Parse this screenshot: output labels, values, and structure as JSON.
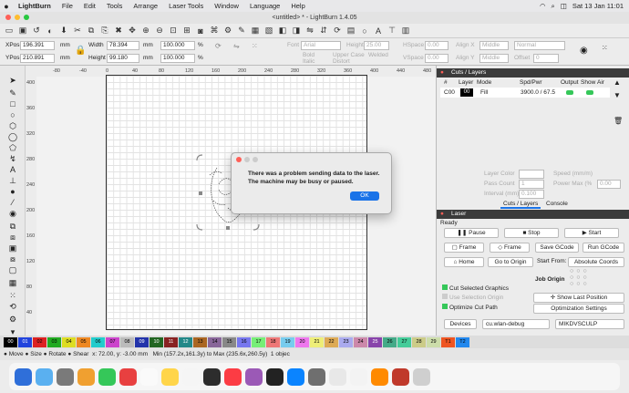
{
  "menubar": {
    "apple": "",
    "app": "LightBurn",
    "items": [
      "File",
      "Edit",
      "Tools",
      "Arrange",
      "Laser Tools",
      "Window",
      "Language",
      "Help"
    ],
    "datetime": "Sat 13 Jan  11:01"
  },
  "window": {
    "title": "<untitled> * - LightBurn 1.4.05"
  },
  "props": {
    "xpos_label": "XPos",
    "xpos": "196.391",
    "ypos_label": "YPos",
    "ypos": "210.891",
    "unit": "mm",
    "width_label": "Width",
    "width": "78.394",
    "height_label": "Height",
    "height": "99.180",
    "pct_w": "100.000",
    "pct_h": "100.000",
    "pct": "%",
    "font_label": "Font",
    "font": "Arial",
    "fheight_label": "Height",
    "fheight": "25.00",
    "hspace_label": "HSpace",
    "hspace": "0.00",
    "vspace_label": "VSpace",
    "vspace": "0.00",
    "alignx_label": "Align X",
    "alignx": "Middle",
    "aligny_label": "Align Y",
    "aligny": "Middle",
    "normal": "Normal",
    "offset_label": "Offset",
    "offset": "0",
    "bold": "Bold",
    "italic": "Italic",
    "upper": "Upper Case",
    "distort": "Distort",
    "welded": "Welded"
  },
  "ruler_top": [
    "-80",
    "-40",
    "0",
    "40",
    "80",
    "120",
    "160",
    "200",
    "240",
    "280",
    "320",
    "360",
    "400",
    "440",
    "480"
  ],
  "ruler_left": [
    "400",
    "360",
    "320",
    "280",
    "240",
    "200",
    "160",
    "120",
    "80",
    "40",
    "0"
  ],
  "dialog": {
    "line1": "There was a problem sending data to the laser.",
    "line2": "The machine may be busy or paused.",
    "ok": "OK"
  },
  "cuts": {
    "title": "Cuts / Layers",
    "headers": [
      "#",
      "Layer",
      "Mode",
      "Spd/Pwr",
      "Output",
      "Show",
      "Air"
    ],
    "row": {
      "num": "C00",
      "layer": "00",
      "mode": "Fill",
      "spd": "3900.0 / 67.5"
    },
    "layer_color": "Layer Color",
    "speed": "Speed (mm/m)",
    "speed_val": "0",
    "pass_count": "Pass Count",
    "pass_val": "1",
    "power_max": "Power Max (%",
    "power_val": "0.00",
    "interval": "Interval (mm)",
    "interval_val": "0.100",
    "tab1": "Cuts / Layers",
    "tab2": "Console"
  },
  "laser": {
    "title": "Laser",
    "status": "Ready",
    "pause": "Pause",
    "stop": "Stop",
    "start": "Start",
    "frame1": "Frame",
    "frame2": "Frame",
    "save_gcode": "Save GCode",
    "run_gcode": "Run GCode",
    "home": "Home",
    "go_origin": "Go to Origin",
    "start_from_label": "Start From:",
    "start_from": "Absolute Coords",
    "job_origin": "Job Origin",
    "cut_selected": "Cut Selected Graphics",
    "use_selection": "Use Selection Origin",
    "optimize": "Optimize Cut Path",
    "show_last": "Show Last Position",
    "opt_settings": "Optimization Settings",
    "devices": "Devices",
    "port": "cu.wlan-debug",
    "machine": "MIKDVSCULP"
  },
  "palette": [
    {
      "l": "00",
      "c": "#000000",
      "t": "#ffffff"
    },
    {
      "l": "01",
      "c": "#2244dd",
      "t": "#ffffff"
    },
    {
      "l": "02",
      "c": "#dd2222",
      "t": "#000000"
    },
    {
      "l": "03",
      "c": "#22aa22",
      "t": "#000000"
    },
    {
      "l": "04",
      "c": "#dddd22",
      "t": "#000000"
    },
    {
      "l": "05",
      "c": "#ee8822",
      "t": "#000000"
    },
    {
      "l": "06",
      "c": "#22cccc",
      "t": "#000000"
    },
    {
      "l": "07",
      "c": "#cc44cc",
      "t": "#000000"
    },
    {
      "l": "08",
      "c": "#bbbbbb",
      "t": "#000000"
    },
    {
      "l": "09",
      "c": "#2233aa",
      "t": "#ffffff"
    },
    {
      "l": "10",
      "c": "#226622",
      "t": "#ffffff"
    },
    {
      "l": "11",
      "c": "#882222",
      "t": "#ffffff"
    },
    {
      "l": "12",
      "c": "#228888",
      "t": "#ffffff"
    },
    {
      "l": "13",
      "c": "#aa6622",
      "t": "#000000"
    },
    {
      "l": "14",
      "c": "#886699",
      "t": "#000000"
    },
    {
      "l": "15",
      "c": "#888888",
      "t": "#000000"
    },
    {
      "l": "16",
      "c": "#7777ee",
      "t": "#000000"
    },
    {
      "l": "17",
      "c": "#77ee77",
      "t": "#000000"
    },
    {
      "l": "18",
      "c": "#ee7777",
      "t": "#000000"
    },
    {
      "l": "19",
      "c": "#77ccee",
      "t": "#000000"
    },
    {
      "l": "20",
      "c": "#ee77ee",
      "t": "#000000"
    },
    {
      "l": "21",
      "c": "#eeee77",
      "t": "#000000"
    },
    {
      "l": "22",
      "c": "#ddaa55",
      "t": "#000000"
    },
    {
      "l": "23",
      "c": "#aaaaee",
      "t": "#000000"
    },
    {
      "l": "24",
      "c": "#cc88aa",
      "t": "#000000"
    },
    {
      "l": "25",
      "c": "#8844aa",
      "t": "#ffffff"
    },
    {
      "l": "26",
      "c": "#44aa88",
      "t": "#000000"
    },
    {
      "l": "27",
      "c": "#44cc99",
      "t": "#000000"
    },
    {
      "l": "28",
      "c": "#cccc88",
      "t": "#000000"
    },
    {
      "l": "29",
      "c": "#ccddaa",
      "t": "#000000"
    },
    {
      "l": "T1",
      "c": "#ee5522",
      "t": "#000000"
    },
    {
      "l": "T2",
      "c": "#2288ee",
      "t": "#000000"
    }
  ],
  "status": {
    "move": "Move",
    "size": "Size",
    "rotate": "Rotate",
    "shear": "Shear",
    "coords": "x: 72.00, y: -3.00 mm",
    "range": "Min (157.2x,161.3y) to Max (235.6x,260.5y)",
    "count": "1 objec"
  },
  "dock_colors": [
    "#2f6fd9",
    "#5ab0f0",
    "#7a7a7a",
    "#f0a030",
    "#35c759",
    "#e84040",
    "#fafafa",
    "#ffd54a",
    "#f5f5f5",
    "#2d2d2d",
    "#fc3c44",
    "#9b59b6",
    "#222222",
    "#0a84ff",
    "#6f6f6f",
    "#e8e8e8",
    "#f3f3f3",
    "#ff8a00",
    "#c0392b",
    "#cfcfcf"
  ]
}
